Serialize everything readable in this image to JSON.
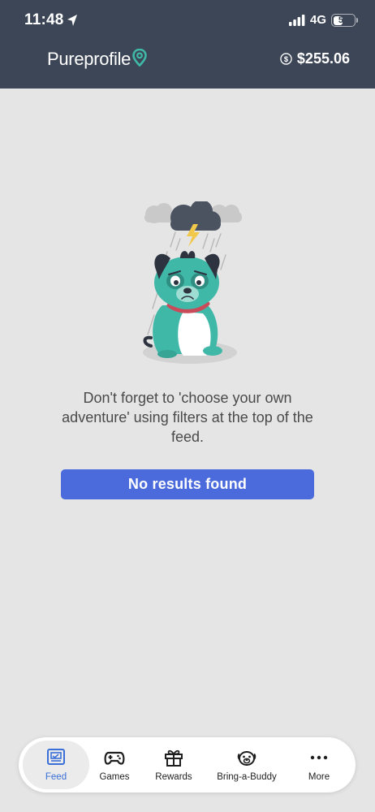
{
  "status_bar": {
    "time": "11:48",
    "network": "4G",
    "battery": "51",
    "battery_level": 0.51
  },
  "header": {
    "logo": "Pureprofile",
    "balance": "$255.06"
  },
  "empty_state": {
    "message": "Don't forget to 'choose your own adventure' using filters at the top of the feed.",
    "button_label": "No results found"
  },
  "bottom_nav": {
    "items": [
      {
        "label": "Feed",
        "icon": "feed-icon",
        "active": true
      },
      {
        "label": "Games",
        "icon": "gamepad-icon",
        "active": false
      },
      {
        "label": "Rewards",
        "icon": "gift-icon",
        "active": false
      },
      {
        "label": "Bring-a-Buddy",
        "icon": "dog-face-icon",
        "active": false
      },
      {
        "label": "More",
        "icon": "more-dots-icon",
        "active": false
      }
    ]
  },
  "colors": {
    "header_bg": "#3d4656",
    "page_bg": "#e5e5e5",
    "button_bg": "#4b6bdc",
    "active_tab": "#3a6fd8",
    "accent_teal": "#3fb8a8"
  }
}
